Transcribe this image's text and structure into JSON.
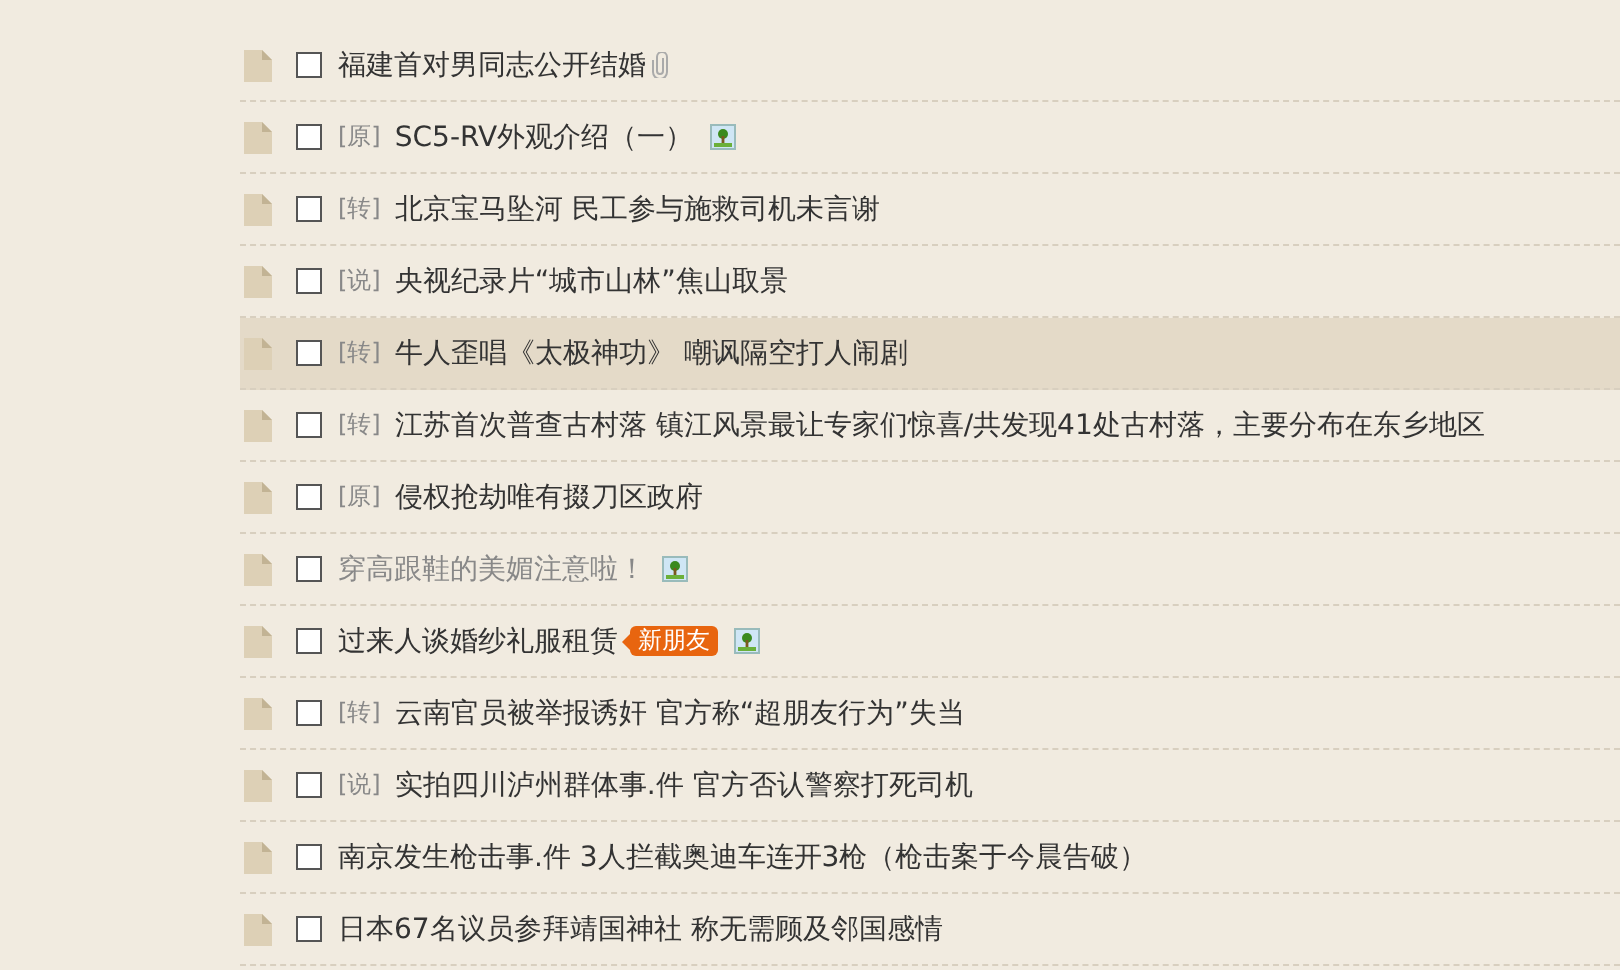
{
  "posts": [
    {
      "title": "福建首对男同志公开结婚",
      "checked": false,
      "hovered": false,
      "visited": false,
      "paperclip": true,
      "image": false
    },
    {
      "tag": "[原]",
      "title": "SC5-RV外观介绍（一）",
      "checked": false,
      "hovered": false,
      "visited": false,
      "paperclip": false,
      "image": true
    },
    {
      "tag": "[转]",
      "title": "北京宝马坠河 民工参与施救司机未言谢",
      "checked": false,
      "hovered": false,
      "visited": false,
      "paperclip": false,
      "image": false
    },
    {
      "tag": "[说]",
      "title": "央视纪录片“城市山林”焦山取景",
      "checked": false,
      "hovered": false,
      "visited": false,
      "paperclip": false,
      "image": false
    },
    {
      "tag": "[转]",
      "title": "牛人歪唱《太极神功》 嘲讽隔空打人闹剧",
      "checked": false,
      "hovered": true,
      "visited": false,
      "paperclip": false,
      "image": false
    },
    {
      "tag": "[转]",
      "title": "江苏首次普查古村落 镇江风景最让专家们惊喜/共发现41处古村落，主要分布在东乡地区",
      "checked": false,
      "hovered": false,
      "visited": false,
      "paperclip": false,
      "image": false
    },
    {
      "tag": "[原]",
      "title": "侵权抢劫唯有掇刀区政府",
      "checked": false,
      "hovered": false,
      "visited": false,
      "paperclip": false,
      "image": false
    },
    {
      "title": "穿高跟鞋的美媚注意啦！",
      "checked": false,
      "hovered": false,
      "visited": true,
      "paperclip": false,
      "image": true
    },
    {
      "title": "过来人谈婚纱礼服租赁",
      "checked": false,
      "hovered": false,
      "visited": false,
      "badge": "新朋友",
      "paperclip": false,
      "image": true
    },
    {
      "tag": "[转]",
      "title": "云南官员被举报诱奸 官方称“超朋友行为”失当",
      "checked": false,
      "hovered": false,
      "visited": false,
      "paperclip": false,
      "image": false
    },
    {
      "tag": "[说]",
      "title": "实拍四川泸州群体事.件 官方否认警察打死司机",
      "checked": false,
      "hovered": false,
      "visited": false,
      "paperclip": false,
      "image": false
    },
    {
      "title": "南京发生枪击事.件 3人拦截奥迪车连开3枪（枪击案于今晨告破）",
      "checked": false,
      "hovered": false,
      "visited": false,
      "paperclip": false,
      "image": false
    },
    {
      "title": "日本67名议员参拜靖国神社 称无需顾及邻国感情",
      "checked": false,
      "hovered": false,
      "visited": false,
      "paperclip": false,
      "image": false
    }
  ]
}
